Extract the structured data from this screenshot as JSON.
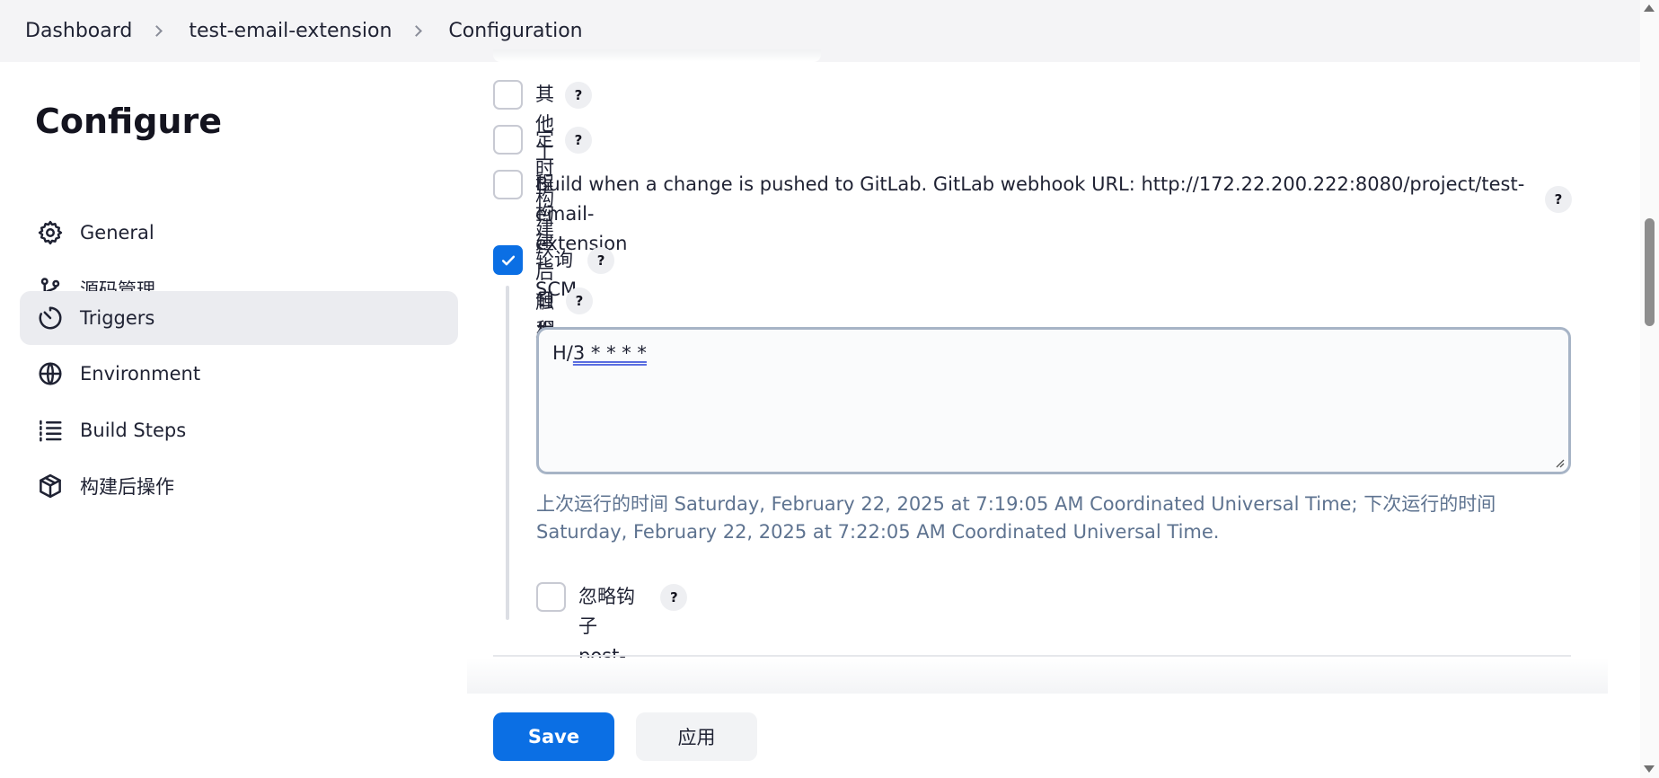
{
  "breadcrumb": {
    "items": [
      "Dashboard",
      "test-email-extension",
      "Configuration"
    ]
  },
  "sidebar": {
    "title": "Configure",
    "items": [
      {
        "label": "General",
        "icon": "gear-icon"
      },
      {
        "label": "源码管理",
        "icon": "branch-icon"
      },
      {
        "label": "Triggers",
        "icon": "clock-icon",
        "active": true
      },
      {
        "label": "Environment",
        "icon": "globe-icon"
      },
      {
        "label": "Build Steps",
        "icon": "list-icon"
      },
      {
        "label": "构建后操作",
        "icon": "package-icon"
      }
    ]
  },
  "triggers": {
    "other_projects": {
      "label": "其他工程构建后触发",
      "checked": false
    },
    "periodic": {
      "label": "定时构建",
      "checked": false
    },
    "gitlab": {
      "label_line1": "Build when a change is pushed to GitLab. GitLab webhook URL: http://172.22.200.222:8080/project/test-email-",
      "label_line2": "extension",
      "checked": false
    },
    "poll_scm": {
      "label": "轮询 SCM",
      "checked": true
    },
    "schedule": {
      "label": "日程表",
      "value_prefix": "H/",
      "value_underlined": "3 * * * *",
      "info": "上次运行的时间 Saturday, February 22, 2025 at 7:19:05 AM Coordinated Universal Time; 下次运行的时间 Saturday, February 22, 2025 at 7:22:05 AM Coordinated Universal Time."
    },
    "ignore_post_commit": {
      "label": "忽略钩子 post-commit",
      "checked": false
    }
  },
  "help_symbol": "?",
  "actions": {
    "save_label": "Save",
    "apply_label": "应用"
  },
  "colors": {
    "accent": "#0b6fe4",
    "info_text": "#5e7390",
    "active_nav": "#ebecf0"
  }
}
